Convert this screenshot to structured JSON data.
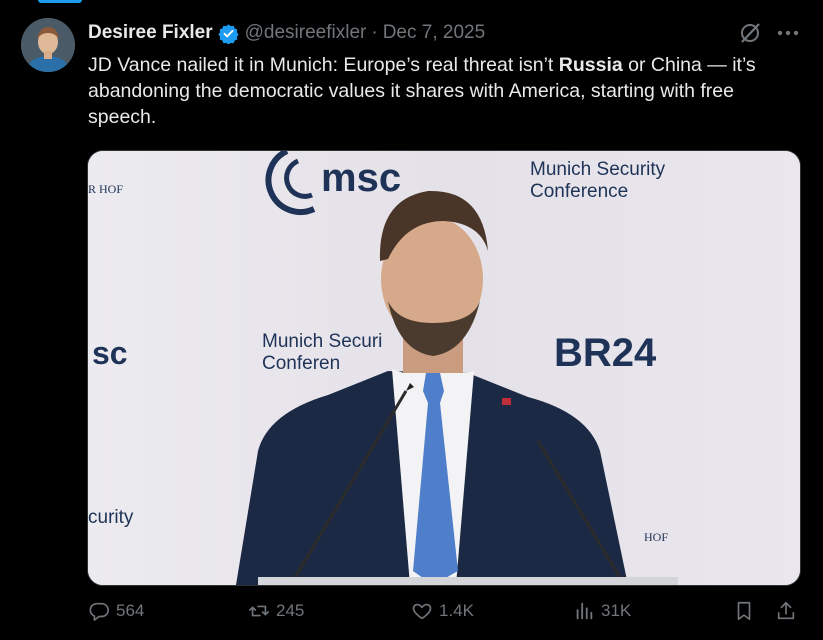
{
  "tweet": {
    "author": {
      "display_name": "Desiree Fixler",
      "handle": "@desireefixler",
      "verified": true
    },
    "separator": "·",
    "date": "Dec 7, 2025",
    "text_parts": [
      "JD Vance nailed it in Munich:  Europe’s real threat isn’t ",
      "Russia",
      " or China — it’s abandoning the democratic values it shares with America, starting with free speech."
    ],
    "media": {
      "backdrop_texts": {
        "msc_logo": "msc",
        "msc_title_line1": "Munich Security",
        "msc_title_line2": "Conference",
        "mid_title_line1": "Munich Securi",
        "mid_title_line2": "Conferen",
        "br24": "BR24",
        "left_sc": "sc",
        "left_curity": "curity",
        "left_hof": "R HOF",
        "right_hof": "HOF"
      }
    },
    "stats": {
      "replies": "564",
      "reposts": "245",
      "likes": "1.4K",
      "views": "31K"
    }
  },
  "colors": {
    "background": "#000000",
    "text_primary": "#e7e9ea",
    "text_secondary": "#71767b",
    "accent": "#1d9bf0"
  },
  "icons": [
    "verified-badge-icon",
    "grok-icon",
    "more-icon",
    "reply-icon",
    "repost-icon",
    "like-icon",
    "views-icon",
    "bookmark-icon",
    "share-icon"
  ]
}
